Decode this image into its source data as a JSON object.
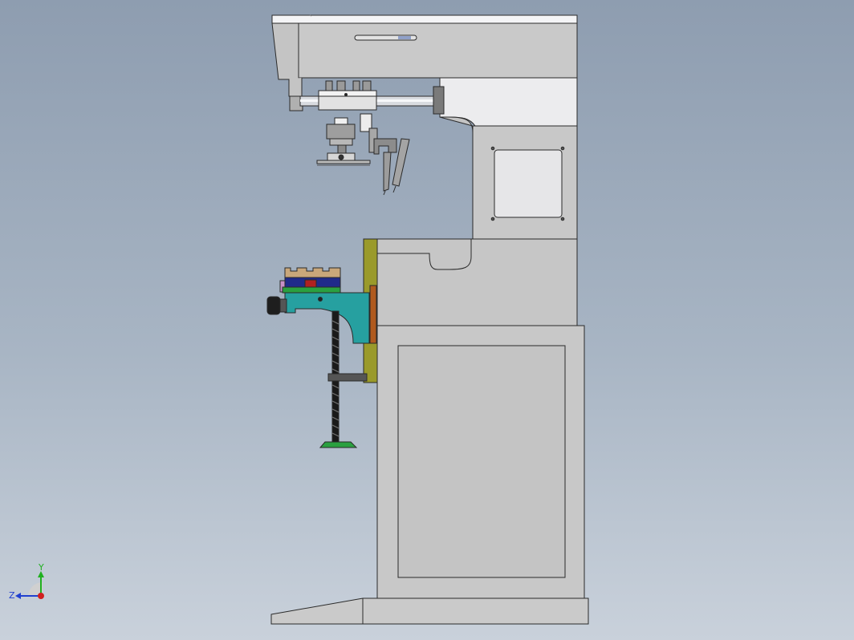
{
  "viewport": {
    "background_top": "#8e9db0",
    "background_bottom": "#c9d1db"
  },
  "model": {
    "description_icon": "machine-side-view-icon",
    "body_color": "#c8c8c8",
    "panel_color": "#e8e8ea",
    "teal_color": "#26a0a0",
    "olive_color": "#9a9a2a",
    "rust_color": "#b05a1e",
    "green_color": "#2aa040",
    "navy_color": "#202a8a",
    "tan_color": "#c9a77a",
    "dark_color": "#222222"
  },
  "triad": {
    "x_color": "#d02020",
    "y_color": "#20b020",
    "z_color": "#2040d0",
    "y_label": "Y",
    "z_label": "Z"
  }
}
